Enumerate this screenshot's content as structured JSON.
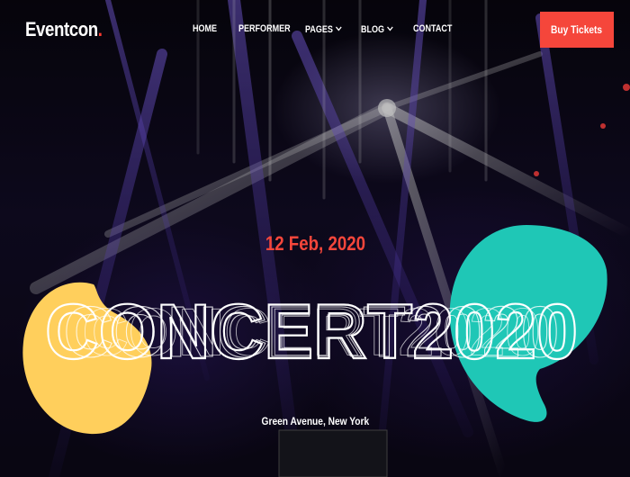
{
  "brand": {
    "name": "Eventcon",
    "dot": "."
  },
  "nav": {
    "items": [
      {
        "label": "HOME",
        "has_dropdown": false
      },
      {
        "label": "PERFORMER",
        "has_dropdown": false
      },
      {
        "label": "PAGES",
        "has_dropdown": true
      },
      {
        "label": "BLOG",
        "has_dropdown": true
      },
      {
        "label": "CONTACT",
        "has_dropdown": false
      }
    ],
    "cta_label": "Buy Tickets"
  },
  "hero": {
    "date": "12 Feb, 2020",
    "headline": "CONCERT2020",
    "venue": "Green Avenue, New York"
  },
  "colors": {
    "accent": "#f5463b",
    "blob_yellow": "#ffcf5c",
    "blob_teal": "#1fc7b6",
    "text": "#ffffff"
  },
  "icons": {
    "dropdown": "chevron-down-icon"
  }
}
